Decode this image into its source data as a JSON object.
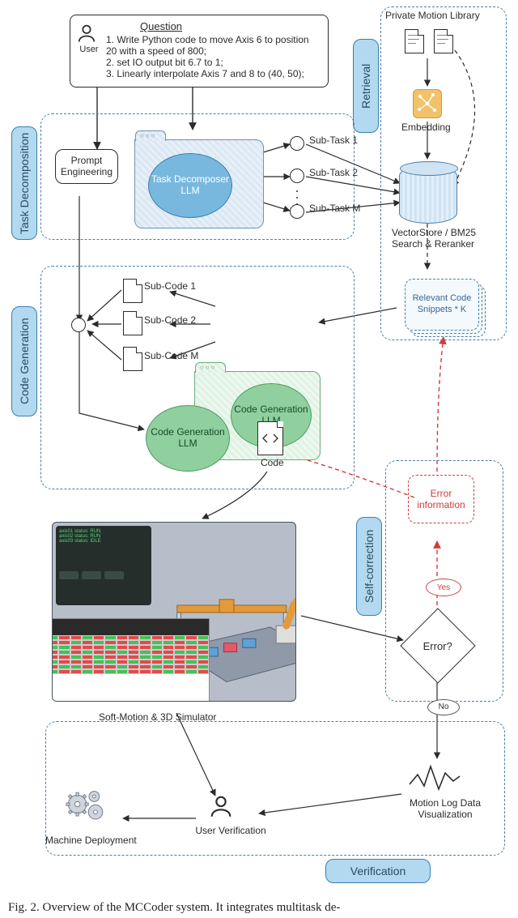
{
  "question": {
    "title": "Question",
    "user_label": "User",
    "lines": [
      "1. Write Python code to move Axis 6 to position 20 with a speed of 800;",
      "2. set IO output bit 6.7 to 1;",
      "3. Linearly interpolate Axis 7 and 8 to (40, 50);"
    ]
  },
  "sections": {
    "retrieval": "Retrieval",
    "task_decomp": "Task Decomposition",
    "code_gen": "Code Generation",
    "self_correction": "Self-correction",
    "verification": "Verification"
  },
  "retrieval": {
    "library_title": "Private Motion Library",
    "embedding": "Embedding",
    "vectorstore": "VectorStore / BM25 Search & Reranker",
    "snippets": "Relevant Code Snippets * K"
  },
  "decomp": {
    "prompt_eng": "Prompt Engineering",
    "decomposer": "Task Decomposer LLM",
    "sub1": "Sub-Task 1",
    "sub2": "Sub-Task 2",
    "subM": "Sub-Task M"
  },
  "codegen": {
    "subcode1": "Sub-Code 1",
    "subcode2": "Sub-Code 2",
    "subcodeM": "Sub-Code M",
    "llm": "Code Generation LLM",
    "code_label": "Code"
  },
  "selfcorr": {
    "error_info": "Error information",
    "error_q": "Error?",
    "yes": "Yes",
    "no": "No"
  },
  "verify": {
    "simulator": "Soft-Motion & 3D Simulator",
    "motion_log": "Motion Log Data Visualization",
    "user_verif": "User Verification",
    "deploy": "Machine Deployment"
  },
  "caption": "Fig. 2.    Overview of the MCCoder system. It integrates multitask de-"
}
